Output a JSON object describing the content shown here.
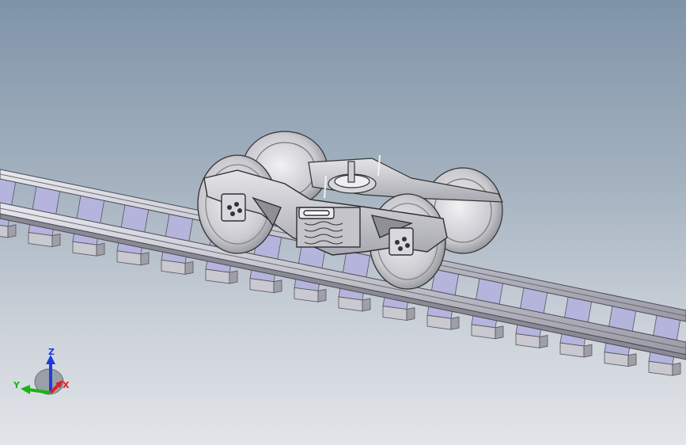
{
  "viewport": {
    "background_top": "#7f93a8",
    "background_bottom": "#e2e5ea",
    "model": "railway-bogie-on-track"
  },
  "triad": {
    "z_label": "Z",
    "y_label": "Y",
    "x_label": "X",
    "colors": {
      "z": "#1f3ce0",
      "y": "#19b419",
      "x": "#e02020"
    }
  }
}
